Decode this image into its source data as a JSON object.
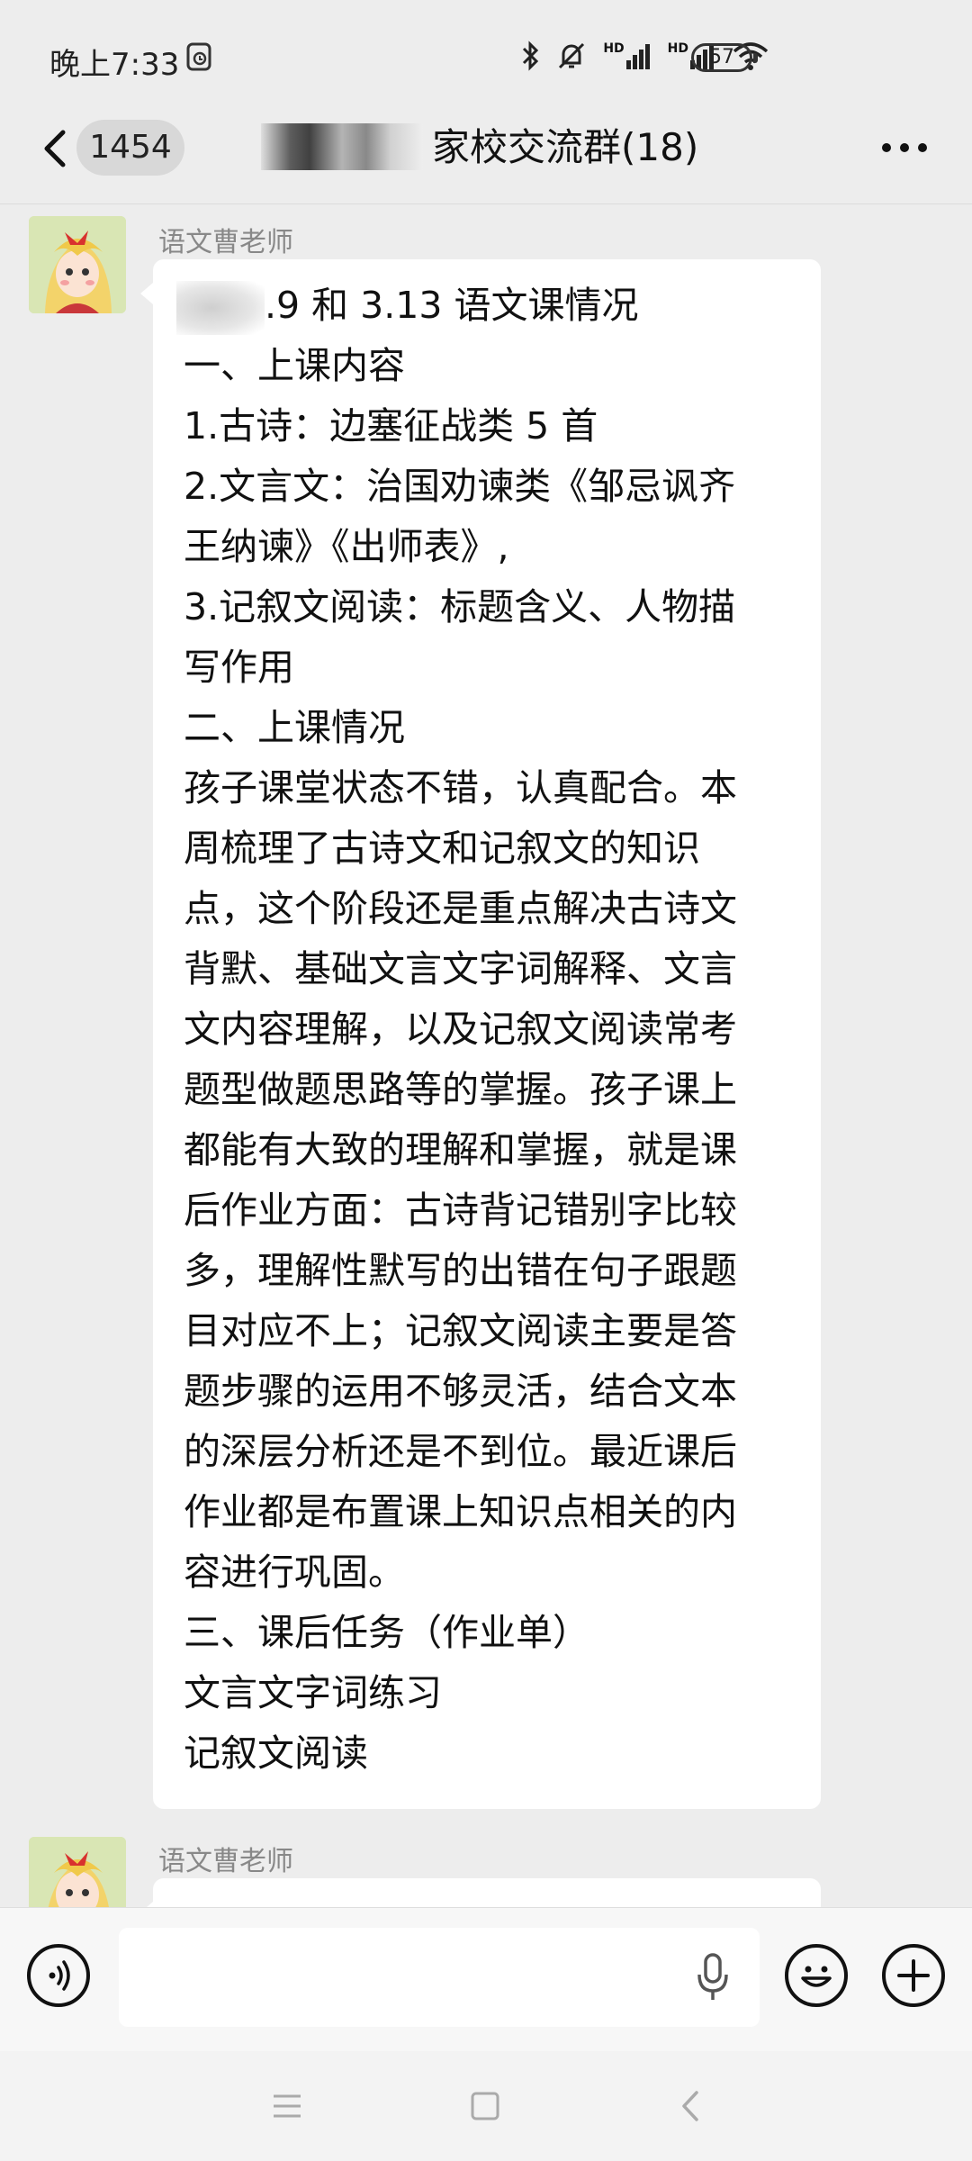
{
  "status_bar": {
    "time": "晚上7:33",
    "hd1": "HD",
    "hd2": "HD",
    "battery": "57"
  },
  "header": {
    "unread_count": "1454",
    "title": "家校交流群(18)"
  },
  "messages": [
    {
      "sender": "语文曹老师",
      "lines": [
        ".9 和 3.13 语文课情况",
        "一、上课内容",
        "1.古诗：边塞征战类 5 首",
        "2.文言文：治国劝谏类《邹忌讽齐",
        "王纳谏》《出师表》,",
        "3.记叙文阅读：标题含义、人物描",
        "写作用",
        "二、上课情况",
        "孩子课堂状态不错，认真配合。本",
        "周梳理了古诗文和记叙文的知识",
        "点，这个阶段还是重点解决古诗文",
        "背默、基础文言文字词解释、文言",
        "文内容理解，以及记叙文阅读常考",
        "题型做题思路等的掌握。孩子课上",
        "都能有大致的理解和掌握，就是课",
        "后作业方面：古诗背记错别字比较",
        "多，理解性默写的出错在句子跟题",
        "目对应不上；记叙文阅读主要是答",
        "题步骤的运用不够灵活，结合文本",
        "的深层分析还是不到位。最近课后",
        "作业都是布置课上知识点相关的内",
        "容进行巩固。",
        "三、课后任务（作业单）",
        "文言文字词练习",
        "记叙文阅读"
      ]
    },
    {
      "sender": "语文曹老师"
    }
  ],
  "icons": {
    "back": "chevron-left-icon",
    "more": "more-horizontal-icon",
    "voice": "voice-icon",
    "mic": "microphone-icon",
    "emoji": "emoji-icon",
    "add": "add-icon",
    "nav_menu": "menu-icon",
    "nav_home": "home-icon",
    "nav_back": "nav-back-icon"
  },
  "colors": {
    "background": "#ededed",
    "bubble": "#ffffff",
    "sender_name": "#888888"
  }
}
